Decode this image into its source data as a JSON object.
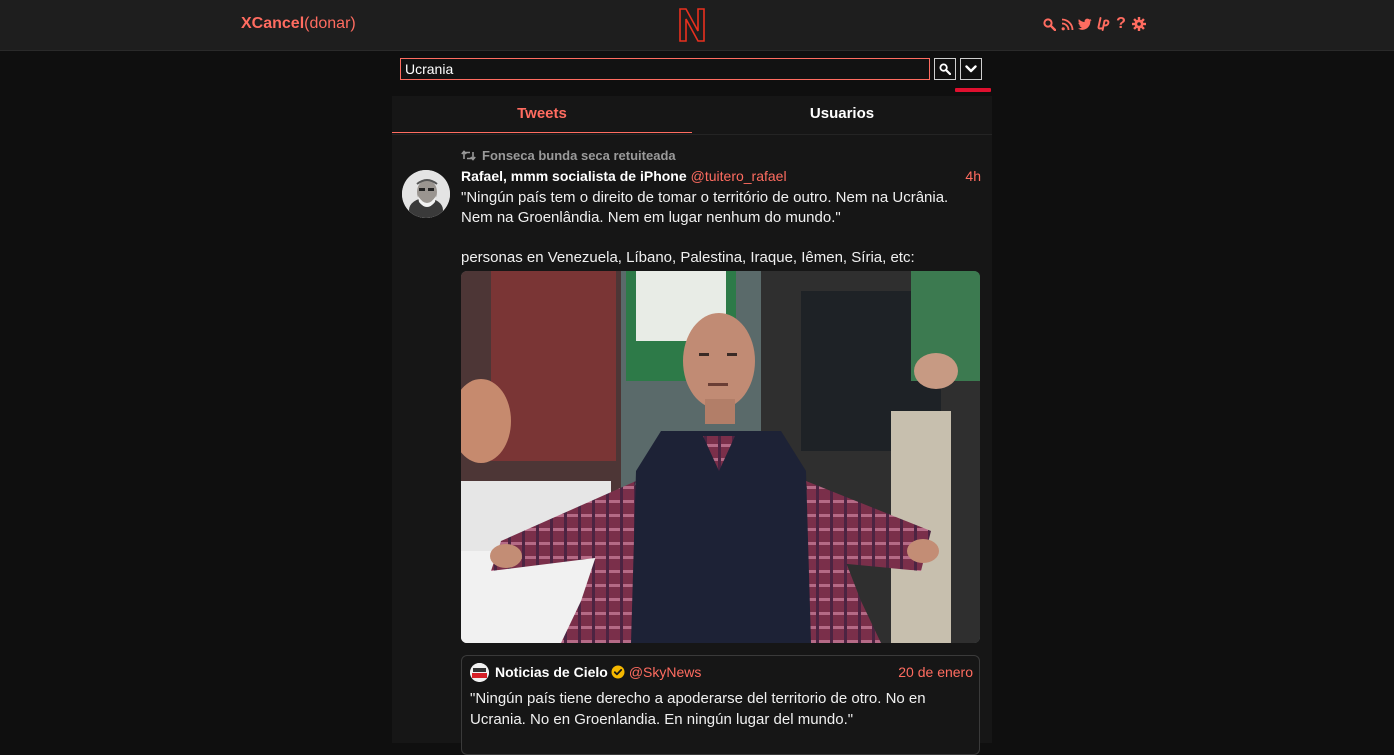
{
  "nav": {
    "brand_name": "XCancel",
    "donate_label": "(donar)",
    "logo_letter": "N",
    "icons": [
      "search-icon",
      "rss-icon",
      "twitter-icon",
      "liberapay-icon",
      "help-icon",
      "gear-icon"
    ],
    "help_glyph": "?"
  },
  "search": {
    "value": "Ucrania"
  },
  "tabs": [
    {
      "label": "Tweets",
      "active": true
    },
    {
      "label": "Usuarios",
      "active": false
    }
  ],
  "tweet": {
    "retweeted_by": "Fonseca bunda seca retuiteada",
    "fullname": "Rafael, mmm socialista de iPhone",
    "username": "@tuitero_rafael",
    "time": "4h",
    "text_lines": [
      "\"Ningún país tem o direito de tomar o território de outro. Nem na Ucrânia. Nem na Groenlândia. Nem em lugar nenhum do mundo.\"",
      "personas en Venezuela, Líbano, Palestina, Iraque, Iêmen, Síria, etc:"
    ],
    "quote": {
      "fullname": "Noticias de Cielo",
      "username": "@SkyNews",
      "date": "20 de enero",
      "text": "\"Ningún país tiene derecho a apoderarse del territorio de otro. No en Ucrania. No en Groenlandia. En ningún lugar del mundo.\""
    }
  },
  "colors": {
    "accent": "#ff6c60",
    "background": "#0f0f0f",
    "panel": "#161616",
    "topbar": "#1e1e1e",
    "underline_red": "#e0102f"
  }
}
